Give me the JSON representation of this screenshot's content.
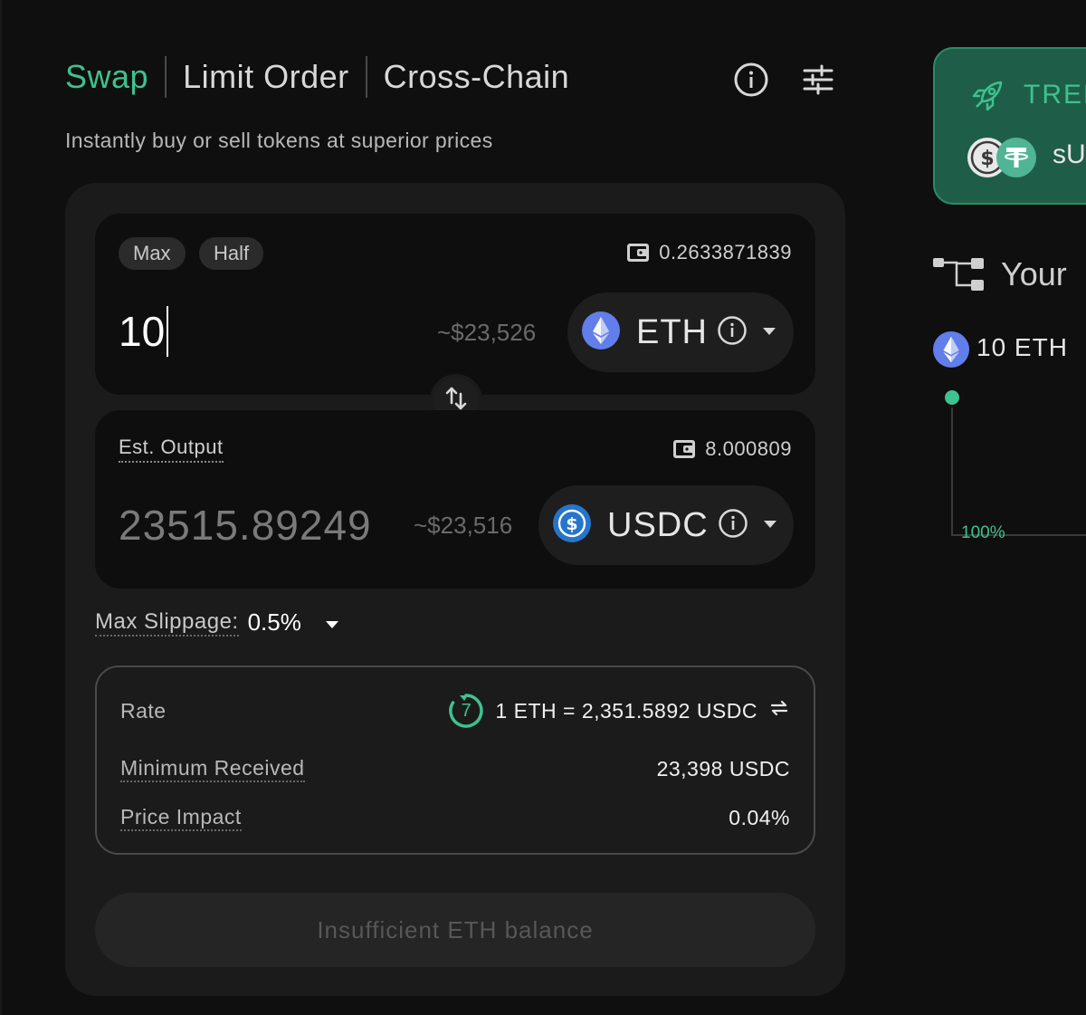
{
  "tabs": [
    {
      "label": "Swap",
      "active": true
    },
    {
      "label": "Limit Order",
      "active": false
    },
    {
      "label": "Cross-Chain",
      "active": false
    }
  ],
  "header_icons": [
    "info-icon",
    "settings-sliders-icon"
  ],
  "subtitle": "Instantly buy or sell tokens at superior prices",
  "from": {
    "max_label": "Max",
    "half_label": "Half",
    "balance": "0.2633871839",
    "amount": "10",
    "usd_value": "~$23,526",
    "token": "ETH"
  },
  "to": {
    "label": "Est. Output",
    "balance": "8.000809",
    "amount": "23515.89249",
    "usd_value": "~$23,516",
    "token": "USDC"
  },
  "slippage": {
    "label": "Max Slippage:",
    "value": "0.5%"
  },
  "details": {
    "rate_label": "Rate",
    "rate_timer": "7",
    "rate_value": "1 ETH = 2,351.5892 USDC",
    "min_received_label": "Minimum Received",
    "min_received_value": "23,398 USDC",
    "price_impact_label": "Price Impact",
    "price_impact_value": "0.04%"
  },
  "submit_label": "Insufficient ETH balance",
  "side": {
    "trending_label": "TREN",
    "trending_token": "sU",
    "route_title": "Your",
    "route_from": "10 ETH",
    "route_pct": "100%"
  },
  "colors": {
    "accent": "#3ec28f",
    "background": "#0f0f0f",
    "card": "#1b1b1b",
    "panel": "#0e0e0e",
    "eth": "#627eea",
    "usdc": "#2775ca"
  }
}
